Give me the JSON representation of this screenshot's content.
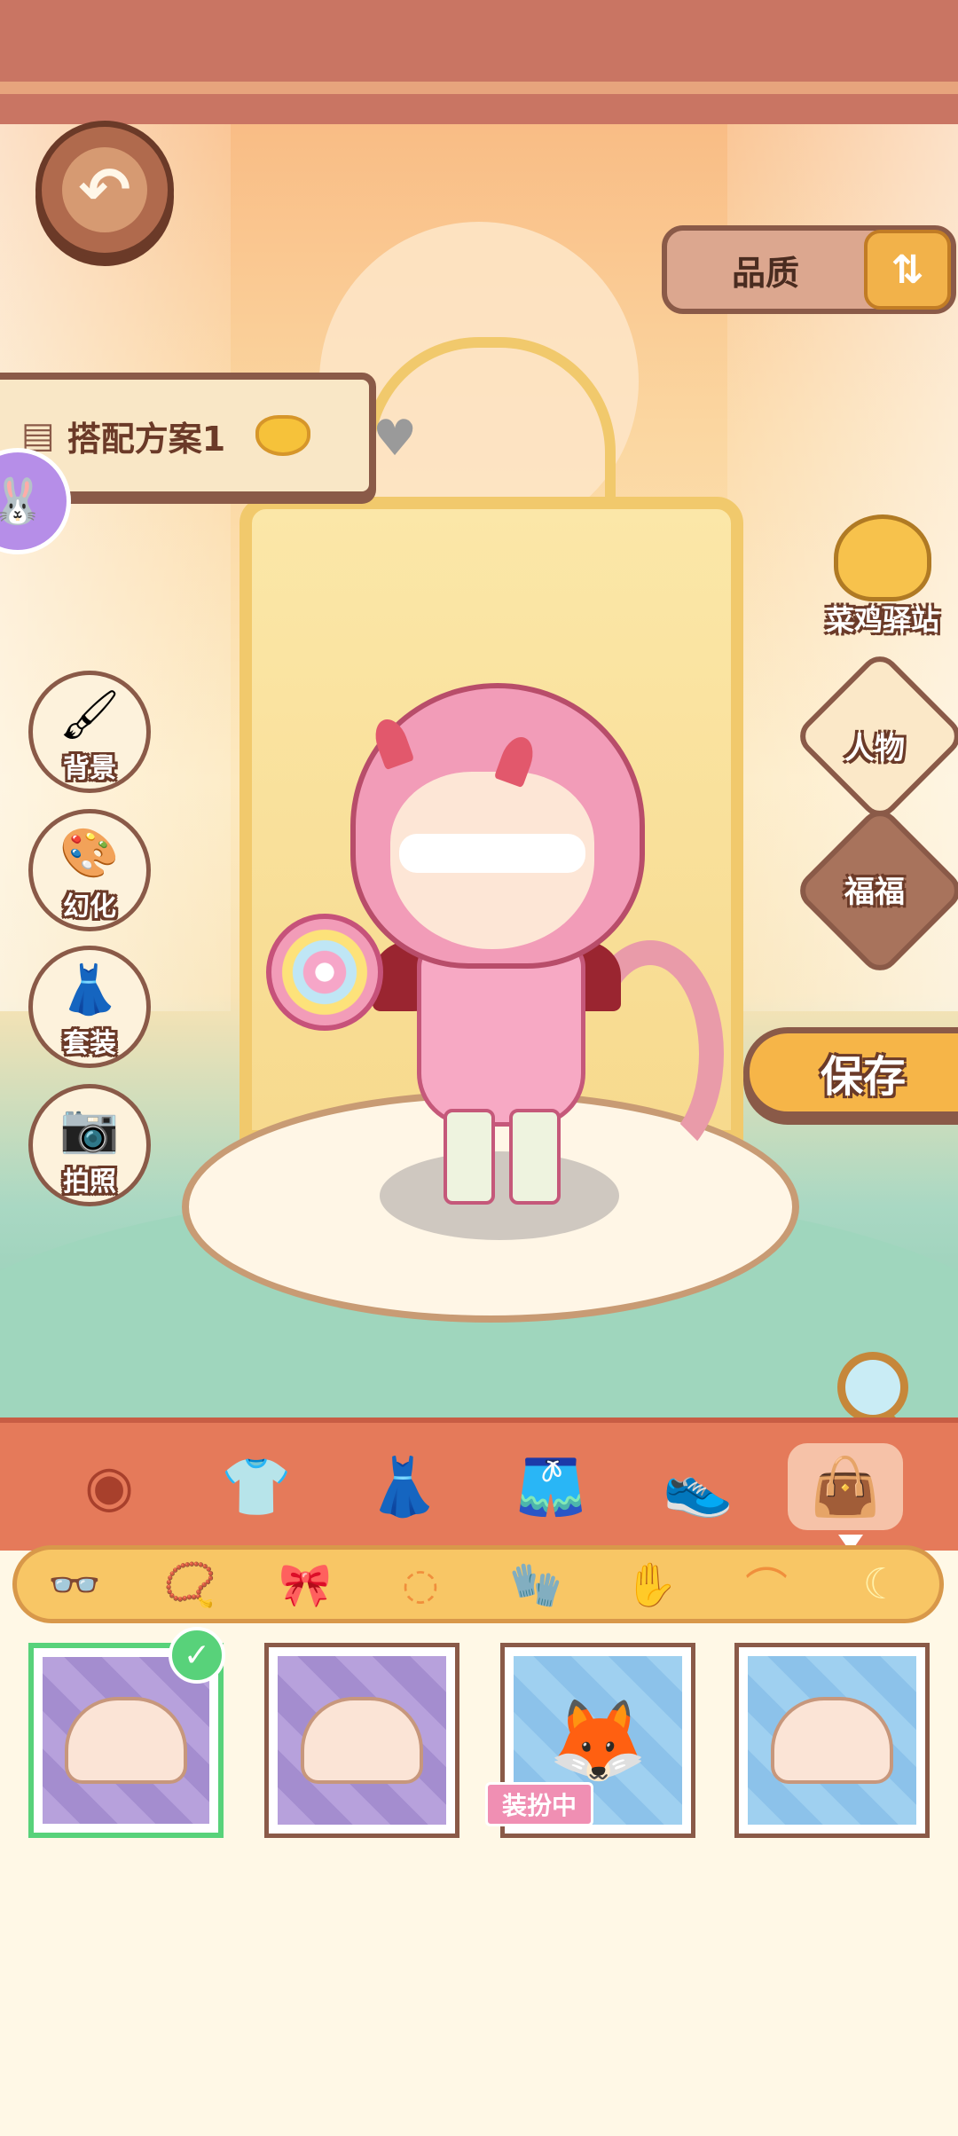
{
  "header": {
    "back_icon": "back-arrow-icon",
    "quality_label": "品质",
    "quality_badge_icon": "quality-badge-icon"
  },
  "plan": {
    "name": "搭配方案1",
    "icon": "document-icon",
    "gem_icon": "gem-icon",
    "favorite_icon": "heart-icon"
  },
  "left_menu": [
    {
      "label": "背景",
      "icon": "brush-icon"
    },
    {
      "label": "幻化",
      "icon": "palette-icon"
    },
    {
      "label": "套装",
      "icon": "hanger-icon"
    },
    {
      "label": "拍照",
      "icon": "camera-icon"
    }
  ],
  "right_menu": {
    "station_label": "菜鸡驿站",
    "character_label": "人物",
    "fufu_label": "福福",
    "save_label": "保存"
  },
  "categories": [
    {
      "icon": "eye-icon",
      "active": false
    },
    {
      "icon": "shirt-icon",
      "active": false
    },
    {
      "icon": "dress-icon",
      "active": false
    },
    {
      "icon": "shorts-icon",
      "active": false
    },
    {
      "icon": "shoe-icon",
      "active": false
    },
    {
      "icon": "bag-icon",
      "active": true
    }
  ],
  "subcategories": [
    {
      "icon": "glasses-icon"
    },
    {
      "icon": "necklace-icon"
    },
    {
      "icon": "bow-icon"
    },
    {
      "icon": "bracelet-icon"
    },
    {
      "icon": "glove-icon"
    },
    {
      "icon": "mitten-icon"
    },
    {
      "icon": "wings-icon"
    },
    {
      "icon": "tail-icon"
    }
  ],
  "items": [
    {
      "tile": "purple",
      "selected": true,
      "tag": ""
    },
    {
      "tile": "purple",
      "selected": false,
      "tag": ""
    },
    {
      "tile": "blue",
      "selected": false,
      "tag": "装扮中"
    },
    {
      "tile": "blue",
      "selected": false,
      "tag": ""
    }
  ],
  "colors": {
    "accent": "#e57a5a",
    "selected": "#58d27a",
    "outline": "#8a5a48"
  }
}
